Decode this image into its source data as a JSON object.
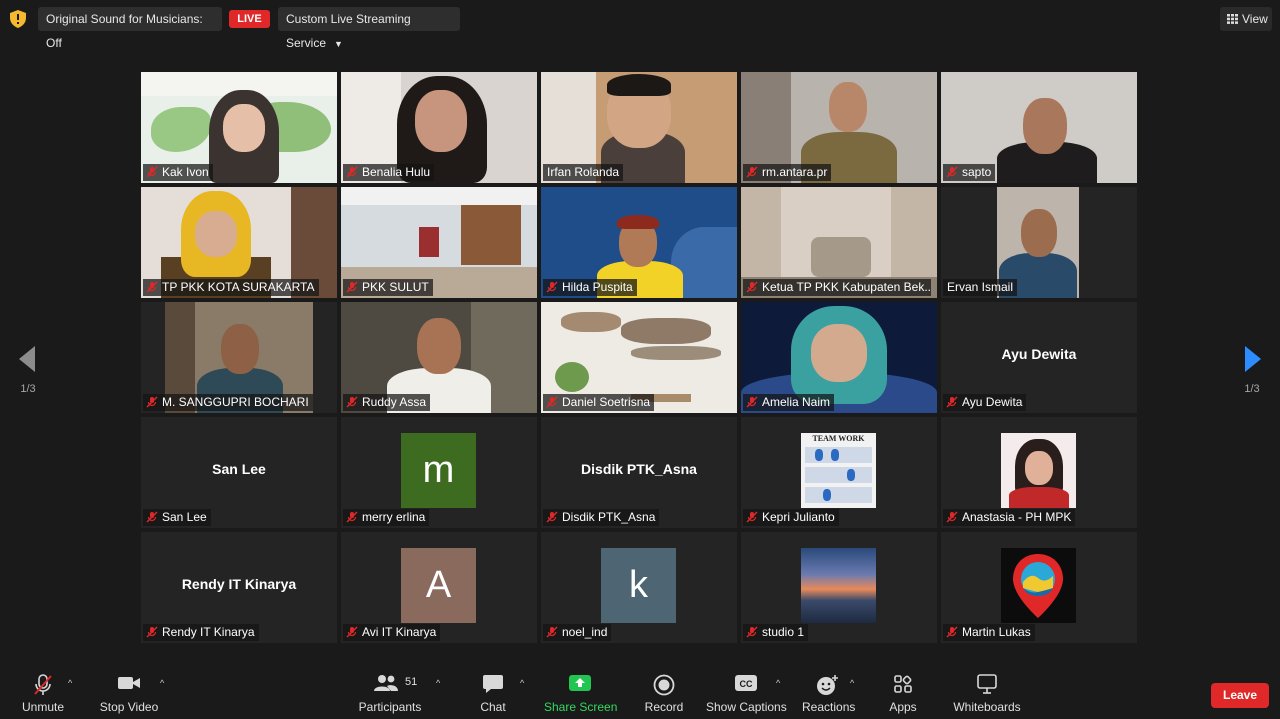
{
  "topbar": {
    "original_sound": "Original Sound for Musicians: Off",
    "live_badge": "LIVE",
    "streaming": "Custom Live Streaming Service",
    "view": "View"
  },
  "pager": {
    "page": "1/3"
  },
  "tiles": [
    {
      "name": "Kak Ivon",
      "kind": "video"
    },
    {
      "name": "Benalia Hulu",
      "kind": "video"
    },
    {
      "name": "Irfan Rolanda",
      "kind": "video",
      "active": true
    },
    {
      "name": "rm.antara.pr",
      "kind": "video"
    },
    {
      "name": "sapto",
      "kind": "video"
    },
    {
      "name": "TP PKK KOTA SURAKARTA",
      "kind": "video"
    },
    {
      "name": "PKK SULUT",
      "kind": "video"
    },
    {
      "name": "Hilda Puspita",
      "kind": "video"
    },
    {
      "name": "Ketua TP PKK Kabupaten Bek...",
      "kind": "video"
    },
    {
      "name": "Ervan Ismail",
      "kind": "video"
    },
    {
      "name": "M. SANGGUPRI BOCHARI",
      "kind": "video"
    },
    {
      "name": "Ruddy Assa",
      "kind": "video"
    },
    {
      "name": "Daniel Soetrisna",
      "kind": "video"
    },
    {
      "name": "Amelia Naim",
      "kind": "video"
    },
    {
      "name": "Ayu Dewita",
      "kind": "text",
      "display": "Ayu Dewita"
    },
    {
      "name": "San Lee",
      "kind": "text",
      "display": "San Lee"
    },
    {
      "name": "merry erlina",
      "kind": "avatar",
      "letter": "m",
      "color": "#3d6b1f"
    },
    {
      "name": "Disdik PTK_Asna",
      "kind": "text",
      "display": "Disdik PTK_Asna"
    },
    {
      "name": "Kepri Julianto",
      "kind": "image",
      "image_text": "TEAM WORK"
    },
    {
      "name": "Anastasia - PH MPK",
      "kind": "image"
    },
    {
      "name": "Rendy IT Kinarya",
      "kind": "text",
      "display": "Rendy IT Kinarya"
    },
    {
      "name": "Avi IT Kinarya",
      "kind": "avatar",
      "letter": "A",
      "color": "#8a6a5c"
    },
    {
      "name": "noel_ind",
      "kind": "avatar",
      "letter": "k",
      "color": "#4e6573"
    },
    {
      "name": "studio 1",
      "kind": "image"
    },
    {
      "name": "Martin Lukas",
      "kind": "image"
    }
  ],
  "toolbar": {
    "unmute": "Unmute",
    "stop_video": "Stop Video",
    "participants": "Participants",
    "participants_count": "51",
    "chat": "Chat",
    "share_screen": "Share Screen",
    "record": "Record",
    "show_captions": "Show Captions",
    "reactions": "Reactions",
    "apps": "Apps",
    "whiteboards": "Whiteboards",
    "leave": "Leave"
  },
  "colors": {
    "background": "#1a1a1a",
    "tile": "#242424",
    "active_border": "#bfe05a",
    "live_red": "#e02828",
    "share_green": "#23c552",
    "muted_red": "#e02828"
  }
}
